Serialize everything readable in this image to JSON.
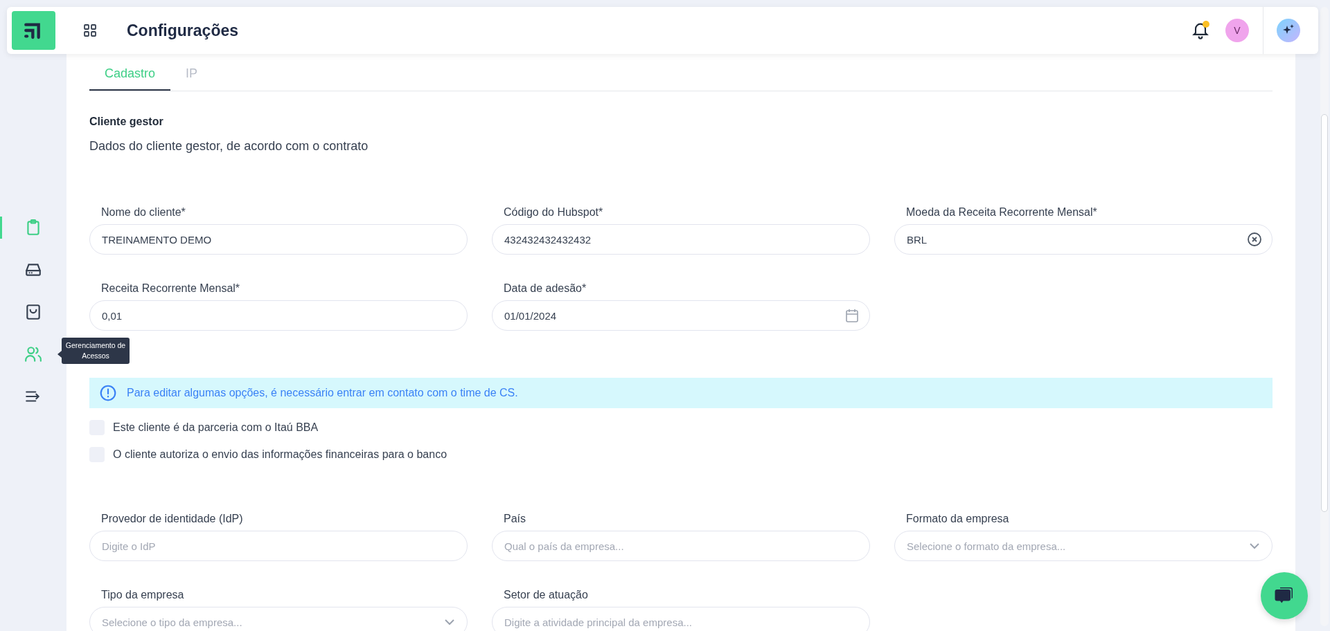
{
  "header": {
    "title": "Configurações",
    "avatar_initial": "V",
    "notification_dot": true
  },
  "sidebar": {
    "items": [
      {
        "kind": "clipboard",
        "selected": true,
        "highlighted": true
      },
      {
        "kind": "drive",
        "selected": false,
        "highlighted": false
      },
      {
        "kind": "bag",
        "selected": false,
        "highlighted": false
      },
      {
        "kind": "users",
        "selected": false,
        "highlighted": true,
        "tooltip": "Gerenciamento de Acessos"
      },
      {
        "kind": "collapse",
        "selected": false,
        "highlighted": false
      }
    ]
  },
  "tabs": [
    {
      "label": "Cadastro",
      "selected": true,
      "disabled": false
    },
    {
      "label": "IP",
      "selected": false,
      "disabled": true
    }
  ],
  "section": {
    "title": "Cliente gestor",
    "subtitle": "Dados do cliente gestor, de acordo com o contrato"
  },
  "fields_top": [
    {
      "label": "Nome do cliente*",
      "kind": "text",
      "value": "TREINAMENTO DEMO"
    },
    {
      "label": "Código do Hubspot*",
      "kind": "text",
      "value": "432432432432432"
    },
    {
      "label": "Moeda da Receita Recorrente Mensal*",
      "kind": "clear-select",
      "value": "BRL"
    },
    {
      "label": "Receita Recorrente Mensal*",
      "kind": "text",
      "value": "0,01"
    },
    {
      "label": "Data de adesão*",
      "kind": "date",
      "value": "01/01/2024"
    }
  ],
  "notice": "Para editar algumas opções, é necessário entrar em contato com o time de CS.",
  "checkboxes": [
    {
      "label": "Este cliente é da parceria com o Itaú BBA",
      "checked": false
    },
    {
      "label": "O cliente autoriza o envio das informações financeiras para o banco",
      "checked": false
    }
  ],
  "fields_bottom": [
    {
      "label": "Provedor de identidade (IdP)",
      "kind": "text",
      "placeholder": "Digite o IdP"
    },
    {
      "label": "País",
      "kind": "text",
      "placeholder": "Qual o país da empresa..."
    },
    {
      "label": "Formato da empresa",
      "kind": "select",
      "placeholder": "Selecione o formato da empresa..."
    },
    {
      "label": "Tipo da empresa",
      "kind": "select",
      "placeholder": "Selecione o tipo da empresa..."
    },
    {
      "label": "Setor de atuação",
      "kind": "text",
      "placeholder": "Digite a atividade principal da empresa..."
    }
  ]
}
